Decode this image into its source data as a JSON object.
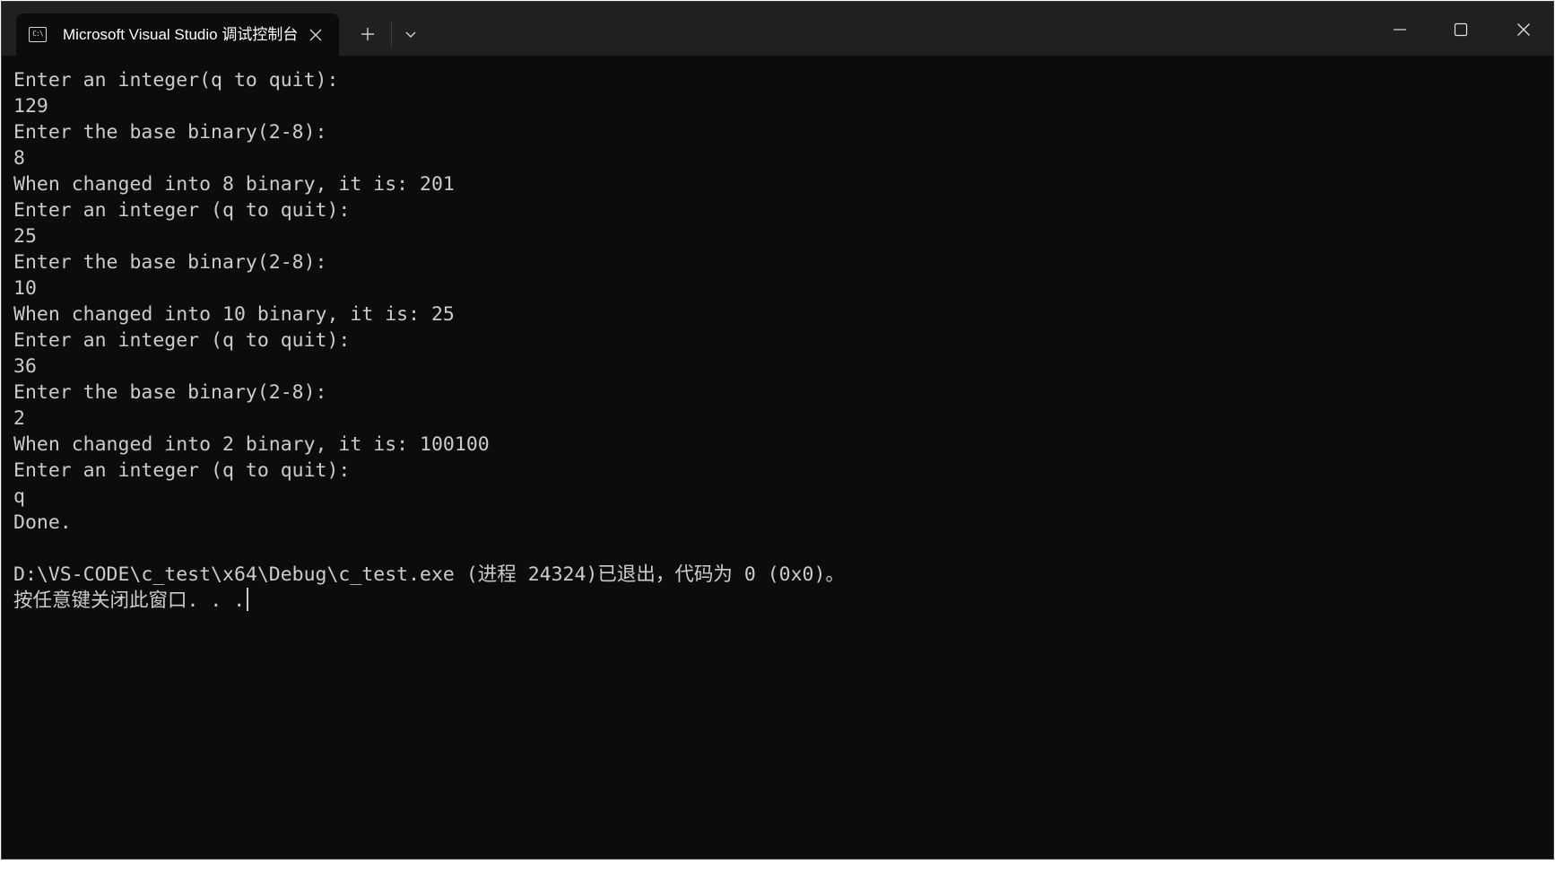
{
  "window": {
    "tab_title": "Microsoft Visual Studio 调试控制台",
    "tab_icon": "console-app-icon",
    "tab_icon_text": "C:\\",
    "controls": [
      "minimize-icon",
      "maximize-icon",
      "close-icon"
    ]
  },
  "console": {
    "lines": [
      "Enter an integer(q to quit):",
      "129",
      "Enter the base binary(2-8):",
      "8",
      "When changed into 8 binary, it is: 201",
      "Enter an integer (q to quit):",
      "25",
      "Enter the base binary(2-8):",
      "10",
      "When changed into 10 binary, it is: 25",
      "Enter an integer (q to quit):",
      "36",
      "Enter the base binary(2-8):",
      "2",
      "When changed into 2 binary, it is: 100100",
      "Enter an integer (q to quit):",
      "q",
      "Done.",
      "",
      "D:\\VS-CODE\\c_test\\x64\\Debug\\c_test.exe (进程 24324)已退出，代码为 0 (0x0)。",
      "按任意键关闭此窗口. . ."
    ]
  },
  "colors": {
    "background": "#0c0c0c",
    "titlebar": "#202020",
    "text": "#cccccc"
  }
}
